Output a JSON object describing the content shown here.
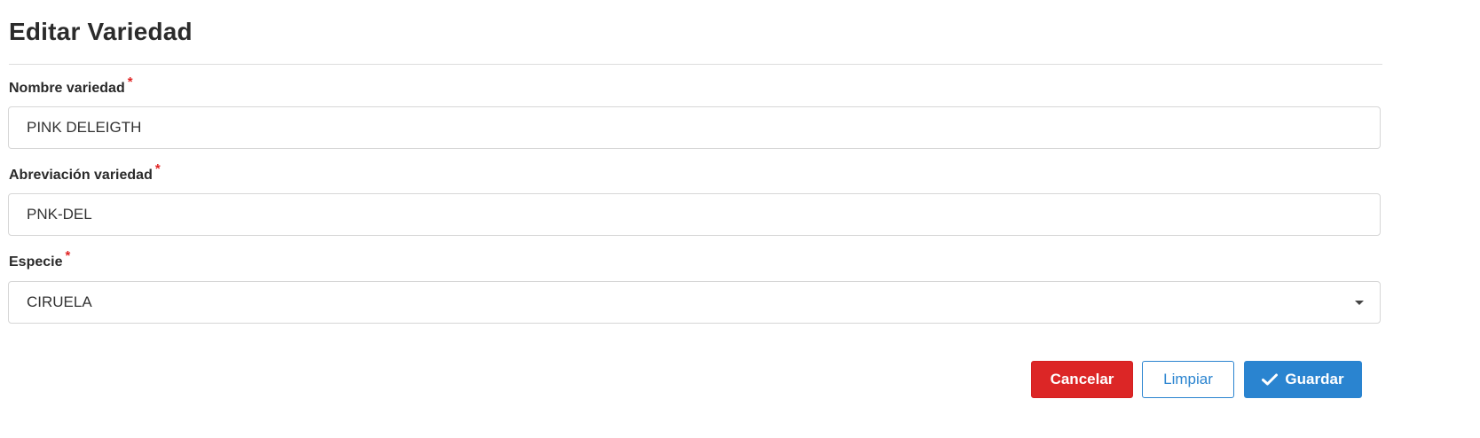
{
  "page": {
    "title": "Editar Variedad"
  },
  "form": {
    "required_marker": "*",
    "fields": [
      {
        "label": "Nombre variedad",
        "value": "PINK DELEIGTH",
        "required": true
      },
      {
        "label": "Abreviación variedad",
        "value": "PNK-DEL",
        "required": true
      },
      {
        "label": "Especie",
        "value": "CIRUELA",
        "required": true,
        "type": "select"
      }
    ]
  },
  "actions": {
    "cancel_label": "Cancelar",
    "clear_label": "Limpiar",
    "save_label": "Guardar",
    "save_icon": "check-icon"
  },
  "colors": {
    "required": "#e02424",
    "cancel": "#dc2626",
    "primary": "#2a84d0"
  }
}
